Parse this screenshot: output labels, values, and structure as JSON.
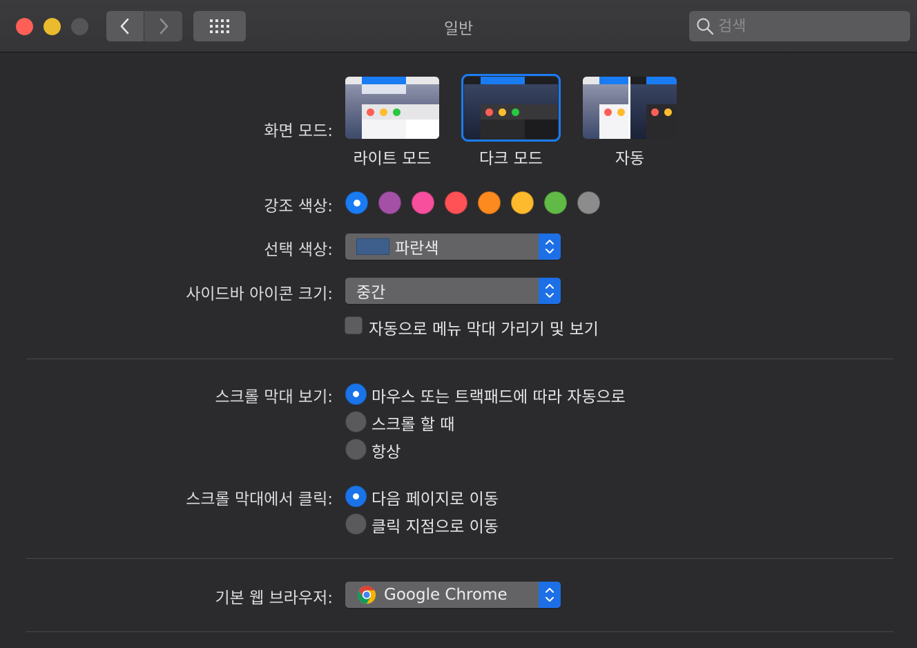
{
  "window": {
    "title": "일반",
    "search_placeholder": "검색"
  },
  "appearance": {
    "label": "화면 모드:",
    "options": [
      {
        "label": "라이트 모드",
        "selected": false
      },
      {
        "label": "다크 모드",
        "selected": true
      },
      {
        "label": "자동",
        "selected": false
      }
    ]
  },
  "accent": {
    "label": "강조 색상:",
    "colors": [
      "#1a7cf4",
      "#a550a7",
      "#f74f9e",
      "#fe5257",
      "#fd8a1f",
      "#fdba2c",
      "#62ba46",
      "#8c8c8c"
    ],
    "selected_index": 0
  },
  "highlight": {
    "label": "선택 색상:",
    "value": "파란색",
    "color": "#3e5f8b"
  },
  "sidebar_icon": {
    "label": "사이드바 아이콘 크기:",
    "value": "중간"
  },
  "menubar": {
    "label": "자동으로 메뉴 막대 가리기 및 보기",
    "checked": false
  },
  "scrollbars": {
    "label": "스크롤 막대 보기:",
    "options": [
      {
        "label": "마우스 또는 트랙패드에 따라 자동으로",
        "selected": true
      },
      {
        "label": "스크롤 할 때",
        "selected": false
      },
      {
        "label": "항상",
        "selected": false
      }
    ]
  },
  "scroll_click": {
    "label": "스크롤 막대에서 클릭:",
    "options": [
      {
        "label": "다음 페이지로 이동",
        "selected": true
      },
      {
        "label": "클릭 지점으로 이동",
        "selected": false
      }
    ]
  },
  "browser": {
    "label": "기본 웹 브라우저:",
    "value": "Google Chrome"
  }
}
